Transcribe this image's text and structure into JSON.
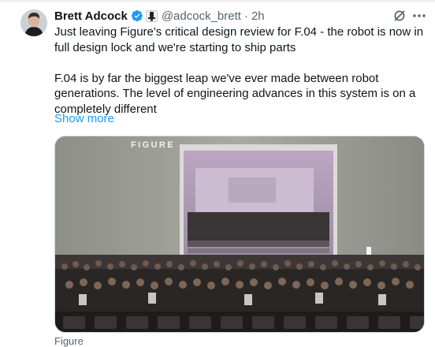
{
  "tweet": {
    "author": {
      "display_name": "Brett Adcock",
      "handle": "@adcock_brett",
      "time": "2h"
    },
    "text_paragraph_1": "Just leaving Figure's critical design review for F.04 - the robot is now in full design lock and we're starting to ship parts",
    "text_paragraph_2": "F.04 is by far the biggest leap we've ever made between robot generations. The level of engineering advances in this system is on a completely different",
    "show_more": "Show more",
    "media": {
      "logo_text": "FIGURE"
    },
    "media_source": "Figure"
  },
  "icons": [
    "verified-badge-icon",
    "affiliate-badge-icon",
    "grok-icon",
    "more-icon"
  ],
  "colors": {
    "link": "#1d9bf0",
    "verified": "#1d9bf0",
    "secondary_text": "#536471"
  }
}
